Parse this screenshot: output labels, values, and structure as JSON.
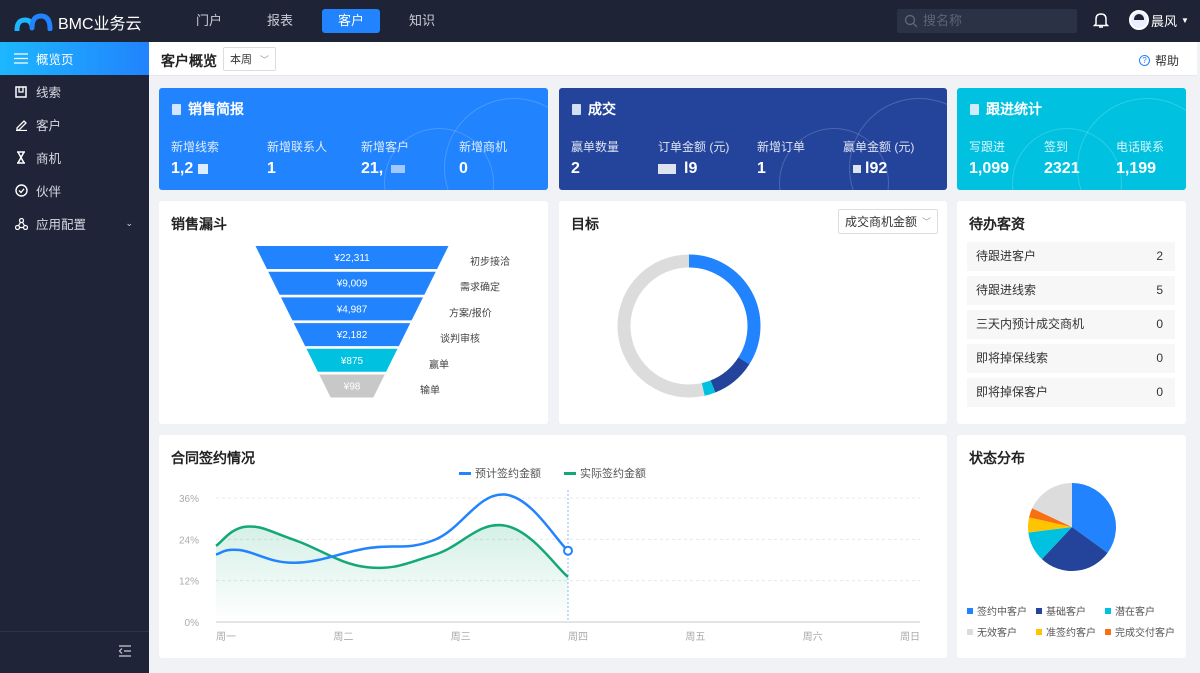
{
  "header": {
    "brand": "BMC业务云",
    "nav": [
      "门户",
      "报表",
      "客户",
      "知识"
    ],
    "active_nav": 2,
    "search_placeholder": "搜名称",
    "user": "晨风"
  },
  "sidebar": {
    "items": [
      {
        "label": "概览页",
        "icon": "menu-icon"
      },
      {
        "label": "线索",
        "icon": "clue-icon"
      },
      {
        "label": "客户",
        "icon": "pen-icon"
      },
      {
        "label": "商机",
        "icon": "hourglass-icon"
      },
      {
        "label": "伙伴",
        "icon": "check-circle-icon"
      },
      {
        "label": "应用配置",
        "icon": "share-nodes-icon"
      }
    ]
  },
  "subheader": {
    "title": "客户概览",
    "period": "本周",
    "help": "帮助"
  },
  "colors": {
    "blue": "#2183fd",
    "navy": "#24449c",
    "cyan": "#00c2e0",
    "grey": "#dcdcdc",
    "yellow": "#ffc400",
    "orange": "#fa6f0f",
    "green": "#12a877"
  },
  "sales_brief": {
    "title": "销售简报",
    "stats": [
      {
        "label": "新增线索",
        "value": "1,2"
      },
      {
        "label": "新增联系人",
        "value": "1"
      },
      {
        "label": "新增客户",
        "value": "21,"
      },
      {
        "label": "新增商机",
        "value": "0"
      }
    ]
  },
  "deals": {
    "title": "成交",
    "stats": [
      {
        "label": "赢单数量",
        "value": "2"
      },
      {
        "label": "订单金额 (元)",
        "value": "l9"
      },
      {
        "label": "新增订单",
        "value": "1"
      },
      {
        "label": "赢单金额 (元)",
        "value": "l92"
      }
    ]
  },
  "followup": {
    "title": "跟进统计",
    "stats": [
      {
        "label": "写跟进",
        "value": "1,099"
      },
      {
        "label": "签到",
        "value": "2321"
      },
      {
        "label": "电话联系",
        "value": "1,199"
      }
    ]
  },
  "funnel": {
    "title": "销售漏斗",
    "stages": [
      {
        "label": "初步接洽",
        "value": "¥22,311",
        "color": "#2183fd"
      },
      {
        "label": "需求确定",
        "value": "¥9,009",
        "color": "#2183fd"
      },
      {
        "label": "方案/报价",
        "value": "¥4,987",
        "color": "#2183fd"
      },
      {
        "label": "谈判审核",
        "value": "¥2,182",
        "color": "#2183fd"
      },
      {
        "label": "赢单",
        "value": "¥875",
        "color": "#00c2e0"
      },
      {
        "label": "输单",
        "value": "¥98",
        "color": "#c8c8c8"
      }
    ]
  },
  "target": {
    "title": "目标",
    "metric": "成交商机金额",
    "segments": [
      {
        "value": 34,
        "color": "#2183fd"
      },
      {
        "value": 10,
        "color": "#24449c"
      },
      {
        "value": 2.5,
        "color": "#00c2e0"
      },
      {
        "value": 53.5,
        "color": "#dcdcdc"
      }
    ]
  },
  "todo": {
    "title": "待办客资",
    "items": [
      {
        "label": "待跟进客户",
        "value": "2"
      },
      {
        "label": "待跟进线索",
        "value": "5"
      },
      {
        "label": "三天内预计成交商机",
        "value": "0"
      },
      {
        "label": "即将掉保线索",
        "value": "0"
      },
      {
        "label": "即将掉保客户",
        "value": "0"
      }
    ]
  },
  "chart_data": [
    {
      "type": "line",
      "title": "合同签约情况",
      "categories": [
        "周一",
        "周二",
        "周三",
        "周四",
        "周五",
        "周六",
        "周日"
      ],
      "ylim": [
        0,
        36
      ],
      "yticks": [
        "0%",
        "12%",
        "24%",
        "36%"
      ],
      "ytick_values": [
        0,
        12,
        24,
        36
      ],
      "legend": "top-center",
      "series": [
        {
          "name": "预计签约金额",
          "color": "#2183fd",
          "points": [
            [
              0,
              19.6
            ],
            [
              0.2,
              20.9
            ],
            [
              0.67,
              17.2
            ],
            [
              1.29,
              21.4
            ],
            [
              1.86,
              23.8
            ],
            [
              2.46,
              37
            ],
            [
              3,
              20.7
            ]
          ]
        },
        {
          "name": "实际签约金额",
          "color": "#12a877",
          "area": true,
          "points": [
            [
              0,
              22.1
            ],
            [
              0.26,
              27.7
            ],
            [
              0.67,
              23.8
            ],
            [
              1.29,
              15.9
            ],
            [
              1.86,
              19.5
            ],
            [
              2.46,
              28
            ],
            [
              3,
              13.1
            ]
          ]
        }
      ]
    },
    {
      "type": "pie",
      "title": "状态分布",
      "legend": "bottom",
      "slices": [
        {
          "name": "签约中客户",
          "value": 35,
          "color": "#2183fd"
        },
        {
          "name": "基础客户",
          "value": 27,
          "color": "#24449c"
        },
        {
          "name": "潜在客户",
          "value": 11,
          "color": "#00c2e0"
        },
        {
          "name": "准签约客户",
          "value": 5.5,
          "color": "#ffc400"
        },
        {
          "name": "完成交付客户",
          "value": 3.5,
          "color": "#fa6f0f"
        },
        {
          "name": "无效客户",
          "value": 18,
          "color": "#dcdcdc"
        }
      ],
      "legend_order": [
        0,
        1,
        2,
        5,
        3,
        4
      ]
    }
  ]
}
